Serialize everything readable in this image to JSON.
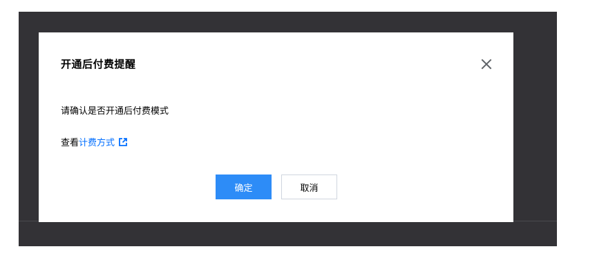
{
  "dialog": {
    "title": "开通后付费提醒",
    "message": "请确认是否开通后付费模式",
    "view_prefix": "查看",
    "view_link": "计费方式",
    "external_link_icon": "external-link-icon",
    "close_icon": "close-icon",
    "confirm_label": "确定",
    "cancel_label": "取消"
  },
  "colors": {
    "overlay": "#333236",
    "primary": "#2d8cf7",
    "link": "#006eff"
  }
}
